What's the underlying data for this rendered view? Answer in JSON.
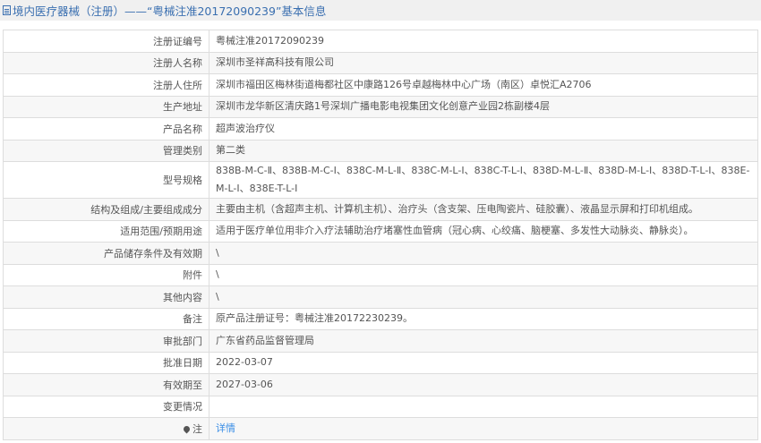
{
  "header": {
    "title": "境内医疗器械（注册）——“粤械注准20172090239”基本信息"
  },
  "rows": [
    {
      "label": "注册证编号",
      "value": "粤械注准20172090239"
    },
    {
      "label": "注册人名称",
      "value": "深圳市圣祥高科技有限公司"
    },
    {
      "label": "注册人住所",
      "value": "深圳市福田区梅林街道梅都社区中康路126号卓越梅林中心广场（南区）卓悦汇A2706"
    },
    {
      "label": "生产地址",
      "value": "深圳市龙华新区清庆路1号深圳广播电影电视集团文化创意产业园2栋副楼4层"
    },
    {
      "label": "产品名称",
      "value": "超声波治疗仪"
    },
    {
      "label": "管理类别",
      "value": "第二类"
    },
    {
      "label": "型号规格",
      "value": "838B-M-C-Ⅱ、838B-M-C-Ⅰ、838C-M-L-Ⅱ、838C-M-L-Ⅰ、838C-T-L-Ⅰ、838D-M-L-Ⅱ、838D-M-L-Ⅰ、838D-T-L-Ⅰ、838E-M-L-Ⅰ、838E-T-L-Ⅰ"
    },
    {
      "label": "结构及组成/主要组成成分",
      "value": "主要由主机（含超声主机、计算机主机）、治疗头（含支架、压电陶瓷片、硅胶囊）、液晶显示屏和打印机组成。"
    },
    {
      "label": "适用范围/预期用途",
      "value": "适用于医疗单位用非介入疗法辅助治疗堵塞性血管病（冠心病、心绞痛、脑梗塞、多发性大动脉炎、静脉炎）。"
    },
    {
      "label": "产品储存条件及有效期",
      "value": "\\"
    },
    {
      "label": "附件",
      "value": "\\"
    },
    {
      "label": "其他内容",
      "value": "\\"
    },
    {
      "label": "备注",
      "value": "原产品注册证号：粤械注准20172230239。"
    },
    {
      "label": "审批部门",
      "value": "广东省药品监督管理局"
    },
    {
      "label": "批准日期",
      "value": "2022-03-07"
    },
    {
      "label": "有效期至",
      "value": "2027-03-06"
    },
    {
      "label": "变更情况",
      "value": ""
    }
  ],
  "note": {
    "label": "注",
    "link": "详情"
  }
}
